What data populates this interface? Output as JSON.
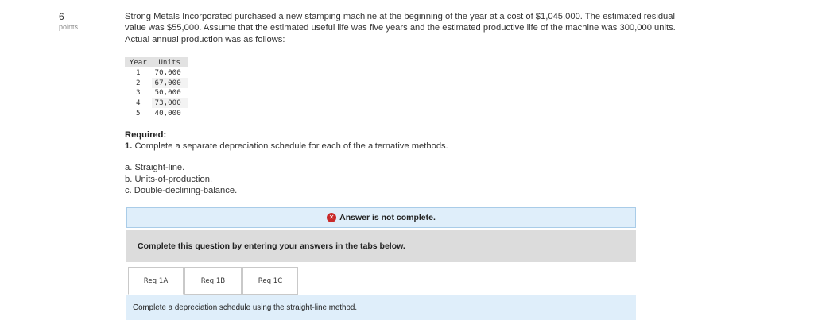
{
  "question": {
    "number": "6",
    "points_label": "points",
    "text": "Strong Metals Incorporated purchased a new stamping machine at the beginning of the year at a cost of $1,045,000. The estimated residual value was $55,000. Assume that the estimated useful life was five years and the estimated productive life of the machine was 300,000 units. Actual annual production was as follows:"
  },
  "production_table": {
    "headers": [
      "Year",
      "Units"
    ],
    "rows": [
      {
        "year": "1",
        "units": "70,000"
      },
      {
        "year": "2",
        "units": "67,000"
      },
      {
        "year": "3",
        "units": "50,000"
      },
      {
        "year": "4",
        "units": "73,000"
      },
      {
        "year": "5",
        "units": "40,000"
      }
    ]
  },
  "required": {
    "heading": "Required:",
    "item_number": "1.",
    "item_text": "Complete a separate depreciation schedule for each of the alternative methods."
  },
  "methods": [
    "a. Straight-line.",
    "b. Units-of-production.",
    "c. Double-declining-balance."
  ],
  "status_banner": {
    "icon": "x-circle-icon",
    "text": "Answer is not complete.",
    "icon_color": "#c92a2a"
  },
  "instruction": "Complete this question by entering your answers in the tabs below.",
  "tabs": [
    {
      "label": "Req 1A",
      "active": true
    },
    {
      "label": "Req 1B",
      "active": false
    },
    {
      "label": "Req 1C",
      "active": false
    }
  ],
  "tab_panel_text": "Complete a depreciation schedule using the straight-line method."
}
